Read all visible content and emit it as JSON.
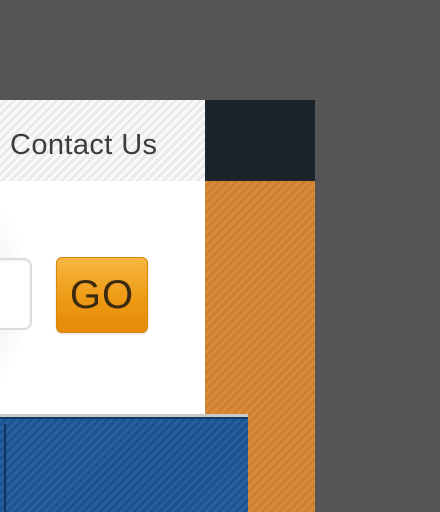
{
  "nav": {
    "contact_label": "Contact Us"
  },
  "search": {
    "go_label": "GO",
    "input_value": ""
  },
  "colors": {
    "page_background": "#555555",
    "header_dark": "#1d232c",
    "orange_panel": "#d5842f",
    "go_button": "#ee9a14",
    "blue_banner": "#1c5796"
  }
}
